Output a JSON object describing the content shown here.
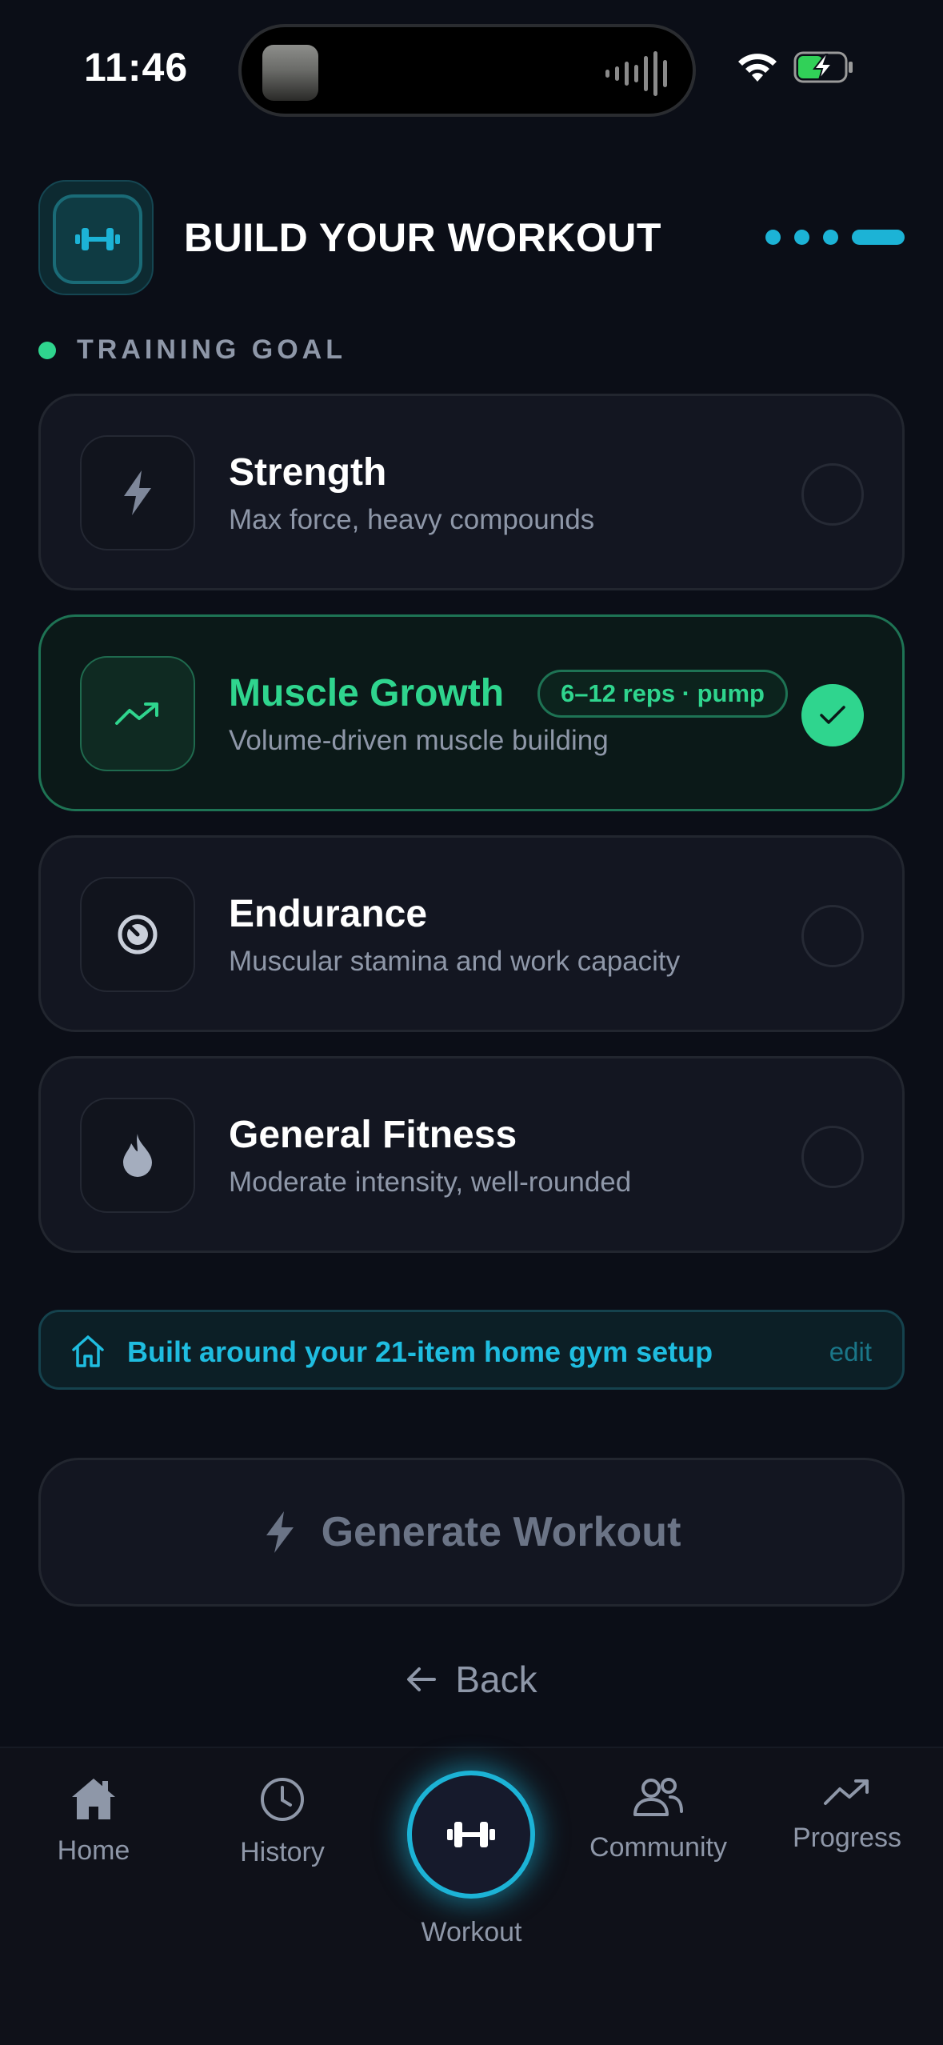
{
  "status_bar": {
    "time": "11:46"
  },
  "header": {
    "title": "BUILD YOUR WORKOUT"
  },
  "section": {
    "label": "TRAINING GOAL"
  },
  "goals": [
    {
      "title": "Strength",
      "subtitle": "Max force, heavy compounds",
      "icon": "lightning-icon",
      "selected": false
    },
    {
      "title": "Muscle Growth",
      "subtitle": "Volume-driven muscle building",
      "icon": "trending-up-icon",
      "selected": true,
      "badge": "6–12 reps · pump"
    },
    {
      "title": "Endurance",
      "subtitle": "Muscular stamina and work capacity",
      "icon": "gauge-icon",
      "selected": false
    },
    {
      "title": "General Fitness",
      "subtitle": "Moderate intensity, well-rounded",
      "icon": "flame-icon",
      "selected": false
    }
  ],
  "home_gym": {
    "text": "Built around your 21-item home gym setup",
    "edit_label": "edit"
  },
  "generate_button": {
    "label": "Generate Workout"
  },
  "back_button": {
    "label": "Back"
  },
  "tab_bar": {
    "home": "Home",
    "history": "History",
    "workout": "Workout",
    "community": "Community",
    "progress": "Progress"
  },
  "colors": {
    "accent_cyan": "#1cb3d6",
    "accent_green": "#2fd58e",
    "background": "#0b0e17",
    "muted_text": "#8e97a8"
  }
}
